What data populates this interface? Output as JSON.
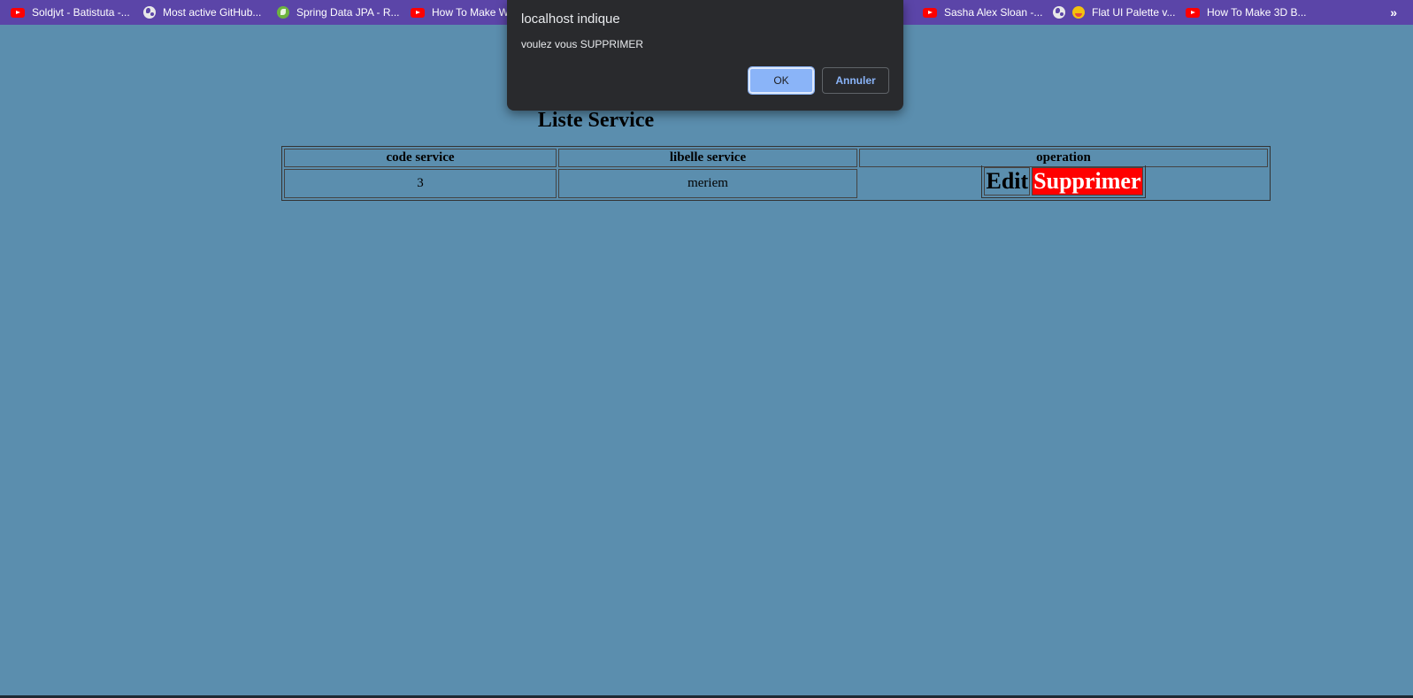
{
  "bookmarks": [
    {
      "label": "Soldjvt - Batistuta -...",
      "icon": "youtube-icon"
    },
    {
      "label": "Most active GitHub...",
      "icon": "globe-icon"
    },
    {
      "label": "Spring Data JPA - R...",
      "icon": "spring-icon"
    },
    {
      "label": "How To Make W",
      "icon": "youtube-icon"
    },
    {
      "label": "...",
      "icon": ""
    },
    {
      "label": "Sasha Alex Sloan -...",
      "icon": "youtube-icon"
    },
    {
      "label": "Flat UI Palette v...",
      "icon": "flat-ui-icon"
    },
    {
      "label": "How To Make 3D B...",
      "icon": "youtube-icon"
    }
  ],
  "bookmarks_more": "»",
  "dialog": {
    "origin": "localhost indique",
    "message": "voulez vous SUPPRIMER",
    "ok_label": "OK",
    "cancel_label": "Annuler"
  },
  "page": {
    "title": "Liste Service",
    "columns": [
      "code service",
      "libelle service",
      "operation"
    ],
    "rows": [
      {
        "code": "3",
        "libelle": "meriem",
        "edit_label": "Edit",
        "delete_label": "Supprimer"
      }
    ]
  },
  "colors": {
    "page_background": "#5b8eae",
    "bookmarks_bar": "#5b45a8",
    "dialog_background": "#292a2d",
    "ok_button": "#8ab4f8",
    "delete_background": "#ff0000"
  }
}
